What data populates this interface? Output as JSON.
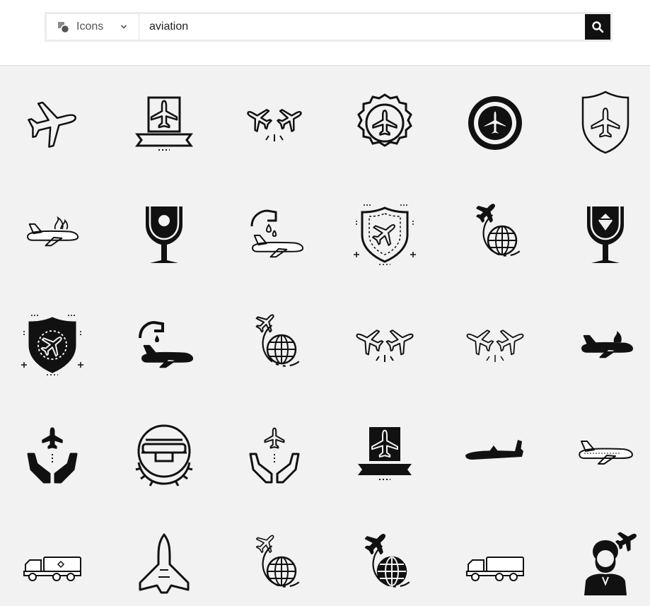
{
  "search": {
    "type_label": "Icons",
    "type_icon": "shapes-icon",
    "query": "aviation",
    "submit_icon": "search-icon"
  },
  "results": {
    "rows": [
      [
        "airplane-outline-icon",
        "plane-frame-banner-icon",
        "crossed-planes-icon",
        "plane-badge-outline-icon",
        "plane-badge-solid-icon",
        "plane-shield-icon"
      ],
      [
        "plane-crash-fire-icon",
        "fragile-glass-icon",
        "plane-refueling-icon",
        "plane-security-shield-icon",
        "global-flight-icon",
        "fragile-glass-diamond-icon"
      ],
      [
        "plane-security-shield-solid-icon",
        "plane-refueling-solid-icon",
        "global-flight-outline-icon",
        "crossed-planes-outline-icon",
        "crossed-planes-thin-icon",
        "plane-crash-solid-icon"
      ],
      [
        "plane-hands-solid-icon",
        "pilot-wings-emblem-icon",
        "plane-hands-outline-icon",
        "plane-frame-banner-solid-icon",
        "military-cargo-plane-icon",
        "passenger-jet-icon"
      ],
      [
        "fuel-truck-icon",
        "space-shuttle-icon",
        "global-flight-thin-icon",
        "global-flight-solid-icon",
        "fuel-truck-outline-icon",
        "flight-attendant-icon"
      ]
    ]
  },
  "colors": {
    "icon": "#111111",
    "background": "#f2f2f2",
    "header": "#ffffff",
    "button": "#111111"
  }
}
